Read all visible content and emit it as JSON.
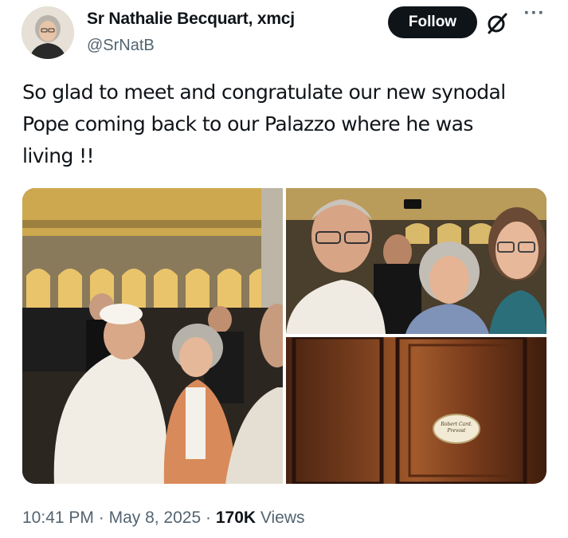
{
  "author": {
    "display_name": "Sr Nathalie Becquart, xmcj",
    "handle": "@SrNatB"
  },
  "actions": {
    "follow_label": "Follow",
    "grok_icon": "grok-icon",
    "more_icon": "more-icon"
  },
  "tweet": {
    "text": "So glad to meet and congratulate our new synodal\nPope coming back to our Palazzo where he was\nliving !!"
  },
  "media": {
    "photo_count": 3,
    "door_plaque_text": "Robert Card. Prevost"
  },
  "meta": {
    "time": "10:41 PM",
    "separator": "·",
    "date": "May 8, 2025",
    "views_count": "170K",
    "views_label": "Views"
  },
  "colors": {
    "text_primary": "#0f1419",
    "text_secondary": "#536471",
    "follow_bg": "#0f1419",
    "follow_text": "#ffffff"
  }
}
